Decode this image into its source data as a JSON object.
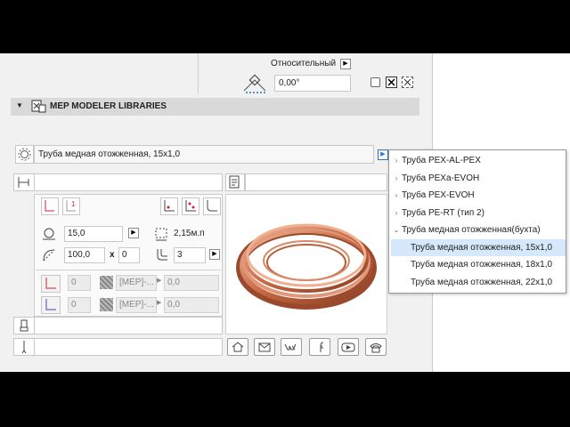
{
  "top": {
    "relative_label": "Относительный",
    "angle_value": "0,00°"
  },
  "section": {
    "title": "MEP MODELER LIBRARIES"
  },
  "selector": {
    "value": "Труба медная отожженная, 15x1,0"
  },
  "params": {
    "diameter": "15,0",
    "length": "2,15м.п",
    "width": "100,0",
    "multiplier": "x",
    "second": "0",
    "count": "3",
    "row1": {
      "num": "0",
      "mat": "[MEP]-...",
      "val": "0,0"
    },
    "row2": {
      "num": "0",
      "mat": "[MEP]-...",
      "val": "0,0"
    }
  },
  "dropdown": {
    "items": [
      {
        "label": "Труба PEX-AL-PEX",
        "chevron": "›"
      },
      {
        "label": "Труба PEXa-EVOH",
        "chevron": "›"
      },
      {
        "label": "Труба PEX-EVOH",
        "chevron": "›"
      },
      {
        "label": "Труба PE-RT (тип 2)",
        "chevron": "›"
      },
      {
        "label": "Труба медная отожженная(бухта)",
        "chevron": "⌄"
      },
      {
        "label": "Труба медная отожженная, 15x1,0",
        "chevron": ""
      },
      {
        "label": "Труба медная отожженная, 18x1,0",
        "chevron": ""
      },
      {
        "label": "Труба медная отожженная, 22x1,0",
        "chevron": ""
      }
    ],
    "selected_index": 5
  },
  "social": [
    "home-icon",
    "mail-icon",
    "vk-icon",
    "facebook-icon",
    "youtube-icon",
    "phone-icon"
  ]
}
